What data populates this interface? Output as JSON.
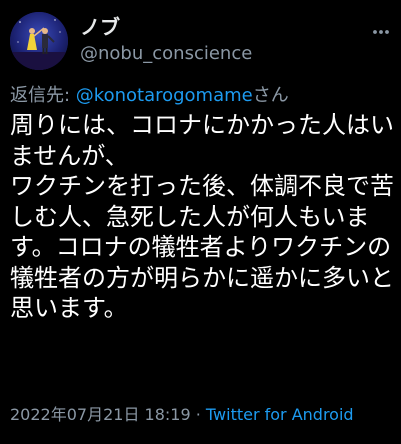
{
  "tweet": {
    "author": {
      "display_name": "ノブ",
      "handle": "@nobu_conscience",
      "avatar_icon": "avatar-dancers-night-image"
    },
    "reply": {
      "prefix": "返信先: ",
      "to": "@konotarogomame",
      "suffix": "さん"
    },
    "text": "周りには、コロナにかかった人はいませんが、\nワクチンを打った後、体調不良で苦しむ人、急死した人が何人もいます。コロナの犠牲者よりワクチンの犠牲者の方が明らかに遥かに多いと思います。",
    "timestamp": "2022年07月21日 18:19",
    "separator": " · ",
    "client": "Twitter for Android",
    "more_icon": "more-dots-icon"
  },
  "colors": {
    "background": "#000000",
    "text": "#ffffff",
    "secondary": "#8b98a5",
    "accent": "#1d9bf0"
  }
}
